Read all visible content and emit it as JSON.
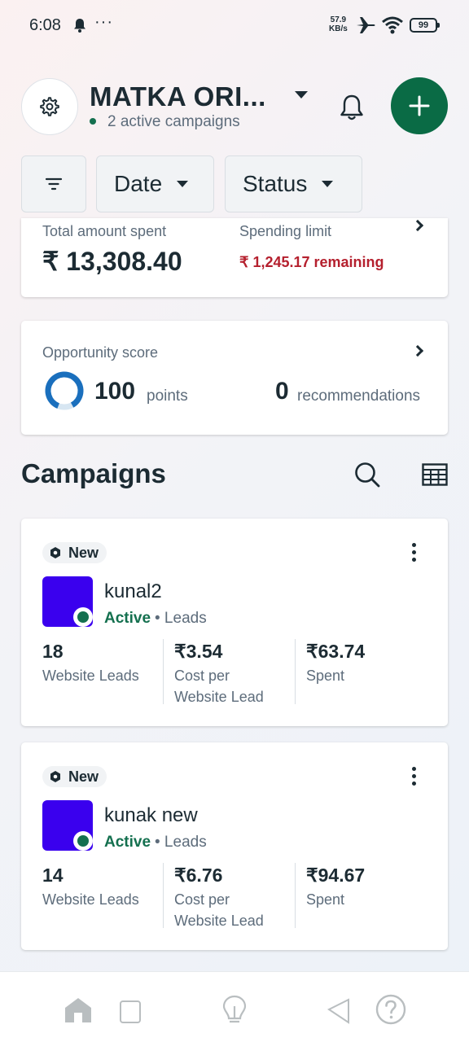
{
  "status_bar": {
    "time": "6:08",
    "dots": "···",
    "net_speed_value": "57.9",
    "net_speed_unit": "KB/s",
    "battery": "99"
  },
  "header": {
    "account_name": "MATKA ORI...",
    "active_campaigns": "2 active campaigns"
  },
  "filters": {
    "date_label": "Date",
    "status_label": "Status"
  },
  "spend": {
    "total_label": "Total amount spent",
    "total_value": "₹ 13,308.40",
    "limit_label": "Spending limit",
    "limit_value": "₹ 1,245.17 remaining"
  },
  "opportunity": {
    "label": "Opportunity score",
    "score": "100",
    "score_unit": "points",
    "recommendations": "0",
    "recommendations_unit": "recommendations",
    "score_fraction": 1.0
  },
  "campaigns": {
    "title": "Campaigns",
    "items": [
      {
        "badge": "New",
        "name": "kunal2",
        "status": "Active",
        "type": "• Leads",
        "metrics": [
          {
            "value": "18",
            "label": "Website Leads"
          },
          {
            "value": "₹3.54",
            "label": "Cost per Website Lead"
          },
          {
            "value": "₹63.74",
            "label": "Spent"
          }
        ]
      },
      {
        "badge": "New",
        "name": "kunak new",
        "status": "Active",
        "type": "• Leads",
        "metrics": [
          {
            "value": "14",
            "label": "Website Leads"
          },
          {
            "value": "₹6.76",
            "label": "Cost per Website Lead"
          },
          {
            "value": "₹94.67",
            "label": "Spent"
          }
        ]
      }
    ]
  },
  "colors": {
    "brand_green": "#0a6b45",
    "active_green": "#14704f",
    "warning_red": "#b5202e",
    "thumbnail_purple": "#3a00ee"
  },
  "icons": [
    "settings-icon",
    "bell-icon",
    "plus-icon",
    "filter-icon",
    "search-icon",
    "table-icon",
    "more-vertical-icon",
    "home-icon",
    "lightbulb-icon",
    "help-icon"
  ]
}
